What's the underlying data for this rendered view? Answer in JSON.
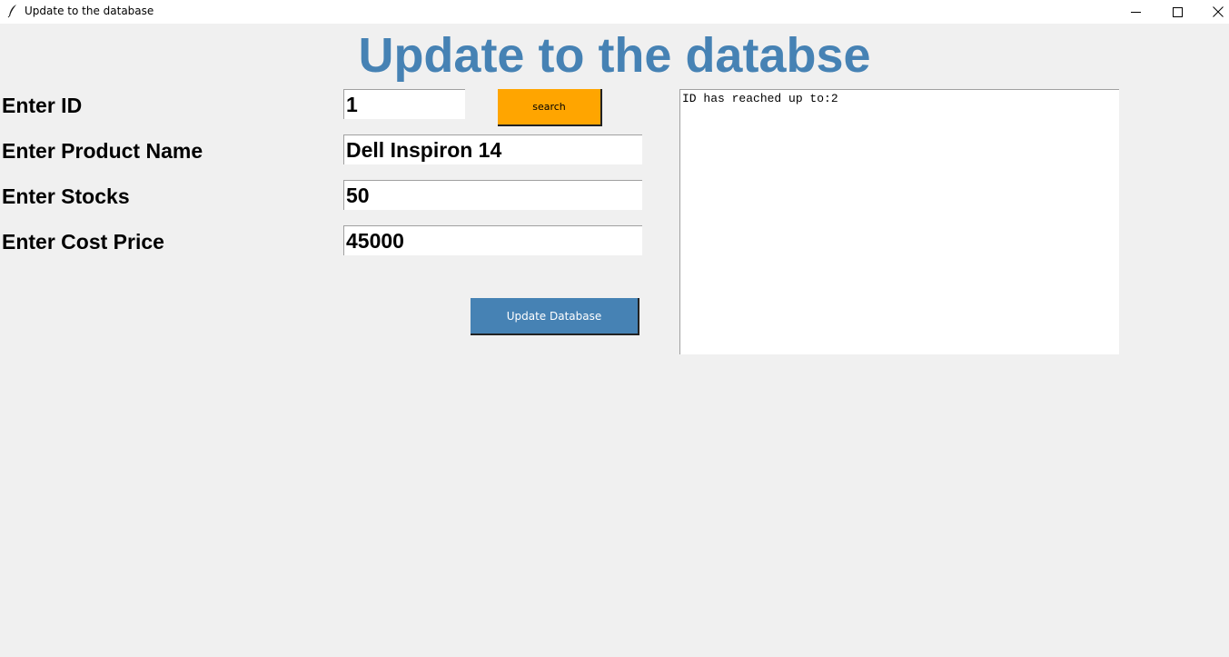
{
  "window": {
    "title": "Update to the database",
    "controls": {
      "minimize_icon": "minimize-icon",
      "maximize_icon": "maximize-icon",
      "close_icon": "close-icon"
    }
  },
  "heading": "Update to the databse",
  "form": {
    "id": {
      "label": "Enter ID",
      "value": "1"
    },
    "product_name": {
      "label": "Enter Product Name",
      "value": "Dell Inspiron 14"
    },
    "stocks": {
      "label": "Enter Stocks",
      "value": "50"
    },
    "cost_price": {
      "label": "Enter Cost Price",
      "value": "45000"
    }
  },
  "buttons": {
    "search": "search",
    "update": "Update Database"
  },
  "output": {
    "text": "ID has reached up to:2"
  },
  "colors": {
    "heading": "#4682b4",
    "search_button": "#ffa500",
    "update_button": "#4682b4",
    "background": "#f0f0f0"
  }
}
